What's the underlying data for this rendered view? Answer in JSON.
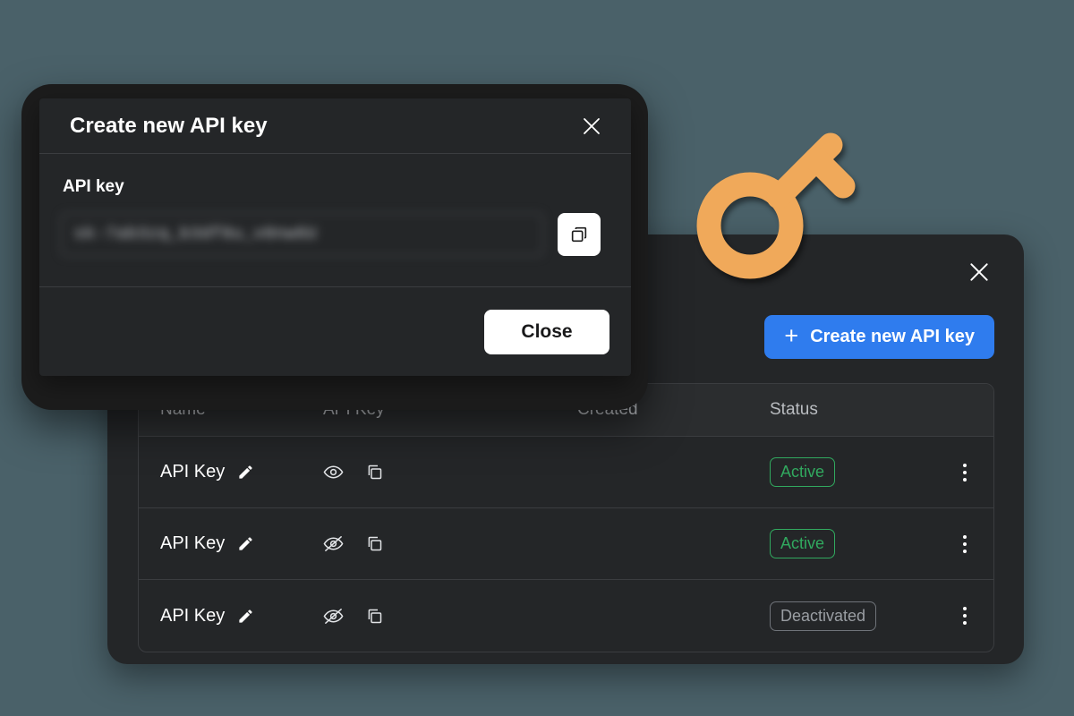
{
  "background_color": "#4a6169",
  "illustration": {
    "name": "key-illustration",
    "color": "#f0a95a"
  },
  "api_keys_panel": {
    "close_icon": "close-icon",
    "create_button": {
      "label": "Create new API key",
      "icon": "plus-icon",
      "color": "#2f7cee"
    },
    "table": {
      "columns": [
        "Name",
        "API Key",
        "Created",
        "Status"
      ],
      "rows": [
        {
          "name": "API Key",
          "edit_icon": "pencil-icon",
          "visibility_icon": "eye-icon",
          "copy_icon": "copy-icon",
          "created": "",
          "status": "Active",
          "status_type": "active",
          "menu_icon": "kebab-menu-icon"
        },
        {
          "name": "API Key",
          "edit_icon": "pencil-icon",
          "visibility_icon": "eye-off-icon",
          "copy_icon": "copy-icon",
          "created": "",
          "status": "Active",
          "status_type": "active",
          "menu_icon": "kebab-menu-icon"
        },
        {
          "name": "API Key",
          "edit_icon": "pencil-icon",
          "visibility_icon": "eye-off-icon",
          "copy_icon": "copy-icon",
          "created": "",
          "status": "Deactivated",
          "status_type": "deactivated",
          "menu_icon": "kebab-menu-icon"
        }
      ]
    },
    "status_colors": {
      "active": "#31a95f",
      "deactivated": "#9a9ea3"
    }
  },
  "create_key_modal": {
    "title": "Create new API key",
    "close_icon": "close-icon",
    "field_label": "API key",
    "api_key_value": "sk-7ab3zq_b3df8u_v0nw6U",
    "api_key_placeholder": "",
    "copy_icon": "copy-icon",
    "close_button_label": "Close"
  }
}
